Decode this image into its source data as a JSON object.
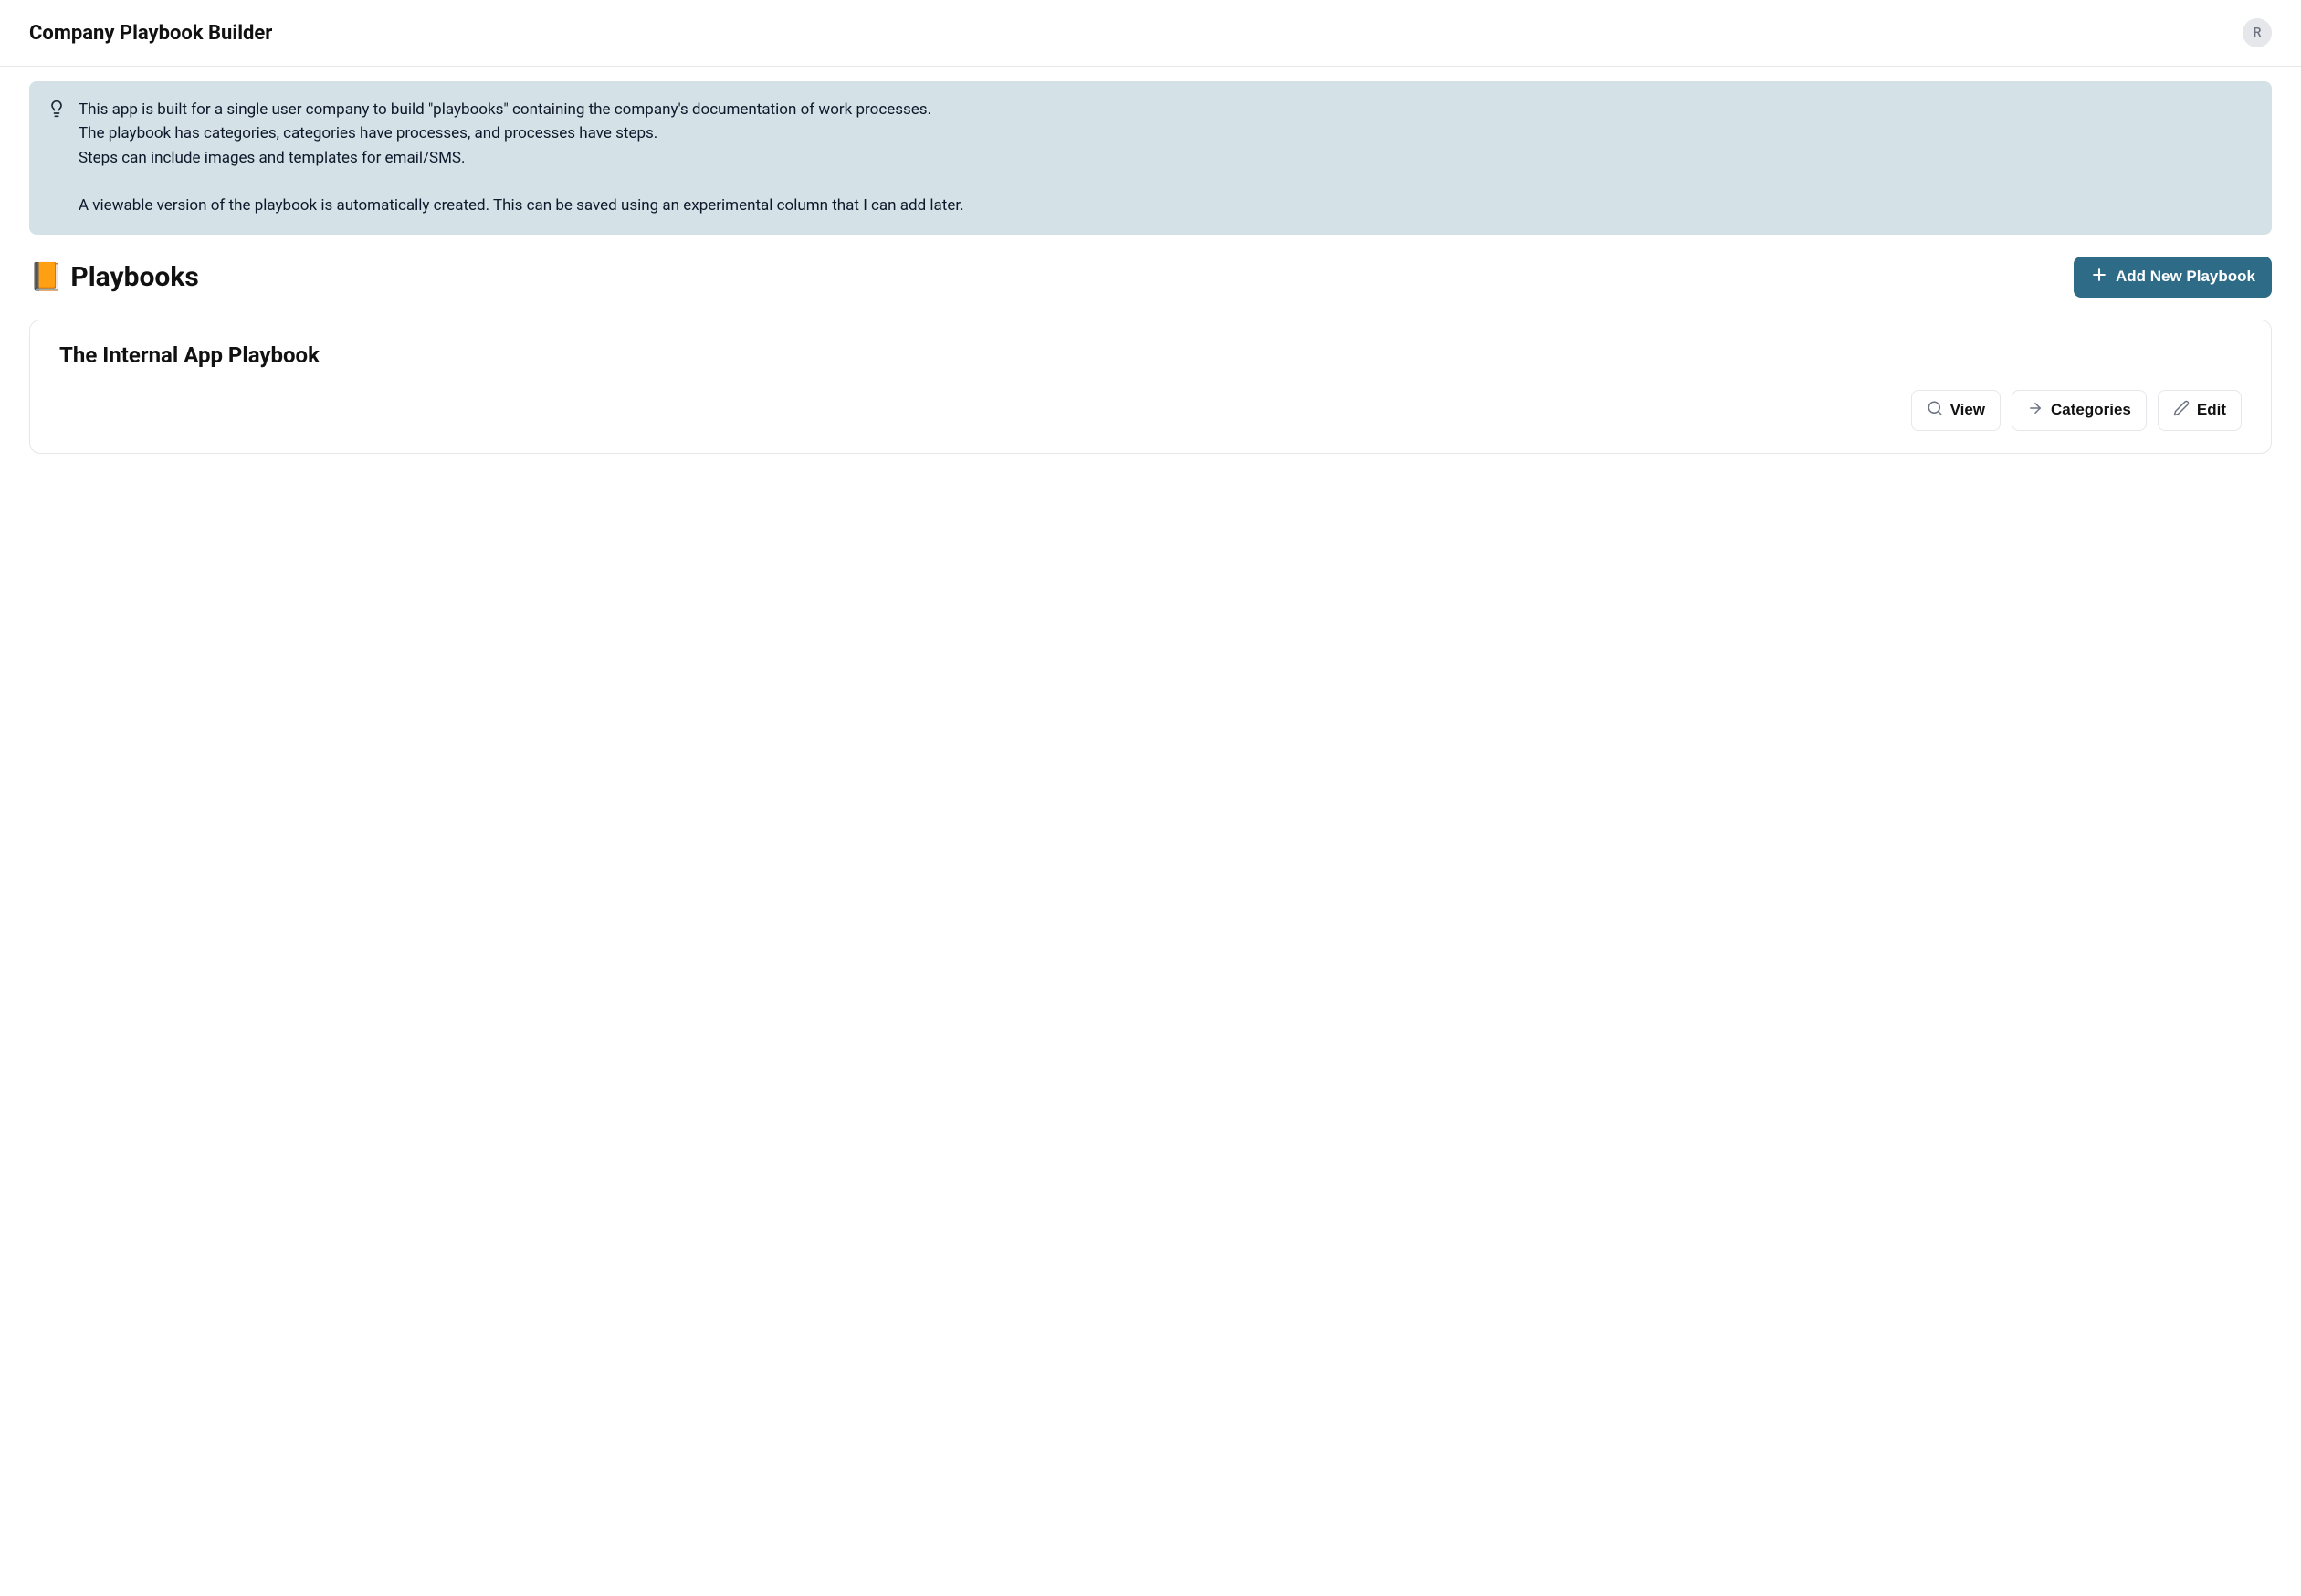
{
  "header": {
    "title": "Company Playbook Builder",
    "avatar_initial": "R"
  },
  "info_banner": {
    "text": "This app is built for a single user company to build \"playbooks\" containing the company's documentation of work processes.\nThe playbook has categories, categories have processes, and processes have steps.\nSteps can include images and templates for email/SMS.\n\nA viewable version of the playbook is automatically created. This can be saved using an experimental column that I can add later."
  },
  "section": {
    "title_emoji": "📙",
    "title": "Playbooks",
    "add_button_label": "Add New Playbook"
  },
  "playbooks": [
    {
      "title": "The Internal App Playbook",
      "actions": {
        "view_label": "View",
        "categories_label": "Categories",
        "edit_label": "Edit"
      }
    }
  ]
}
